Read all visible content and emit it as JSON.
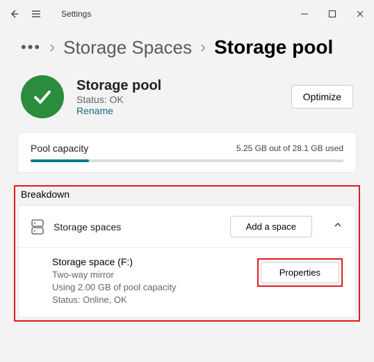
{
  "titlebar": {
    "title": "Settings"
  },
  "breadcrumb": {
    "parent": "Storage Spaces",
    "current": "Storage pool"
  },
  "pool": {
    "title": "Storage pool",
    "status": "Status: OK",
    "rename": "Rename",
    "optimize": "Optimize"
  },
  "capacity": {
    "label": "Pool capacity",
    "value": "5.25 GB out of 28.1 GB used",
    "percent": 18.7
  },
  "breakdown": {
    "title": "Breakdown",
    "spaces_label": "Storage spaces",
    "add_space": "Add a space",
    "space": {
      "name": "Storage space (F:)",
      "mirror": "Two-way mirror",
      "usage": "Using 2.00 GB of pool capacity",
      "status": "Status: Online, OK",
      "properties": "Properties"
    }
  }
}
